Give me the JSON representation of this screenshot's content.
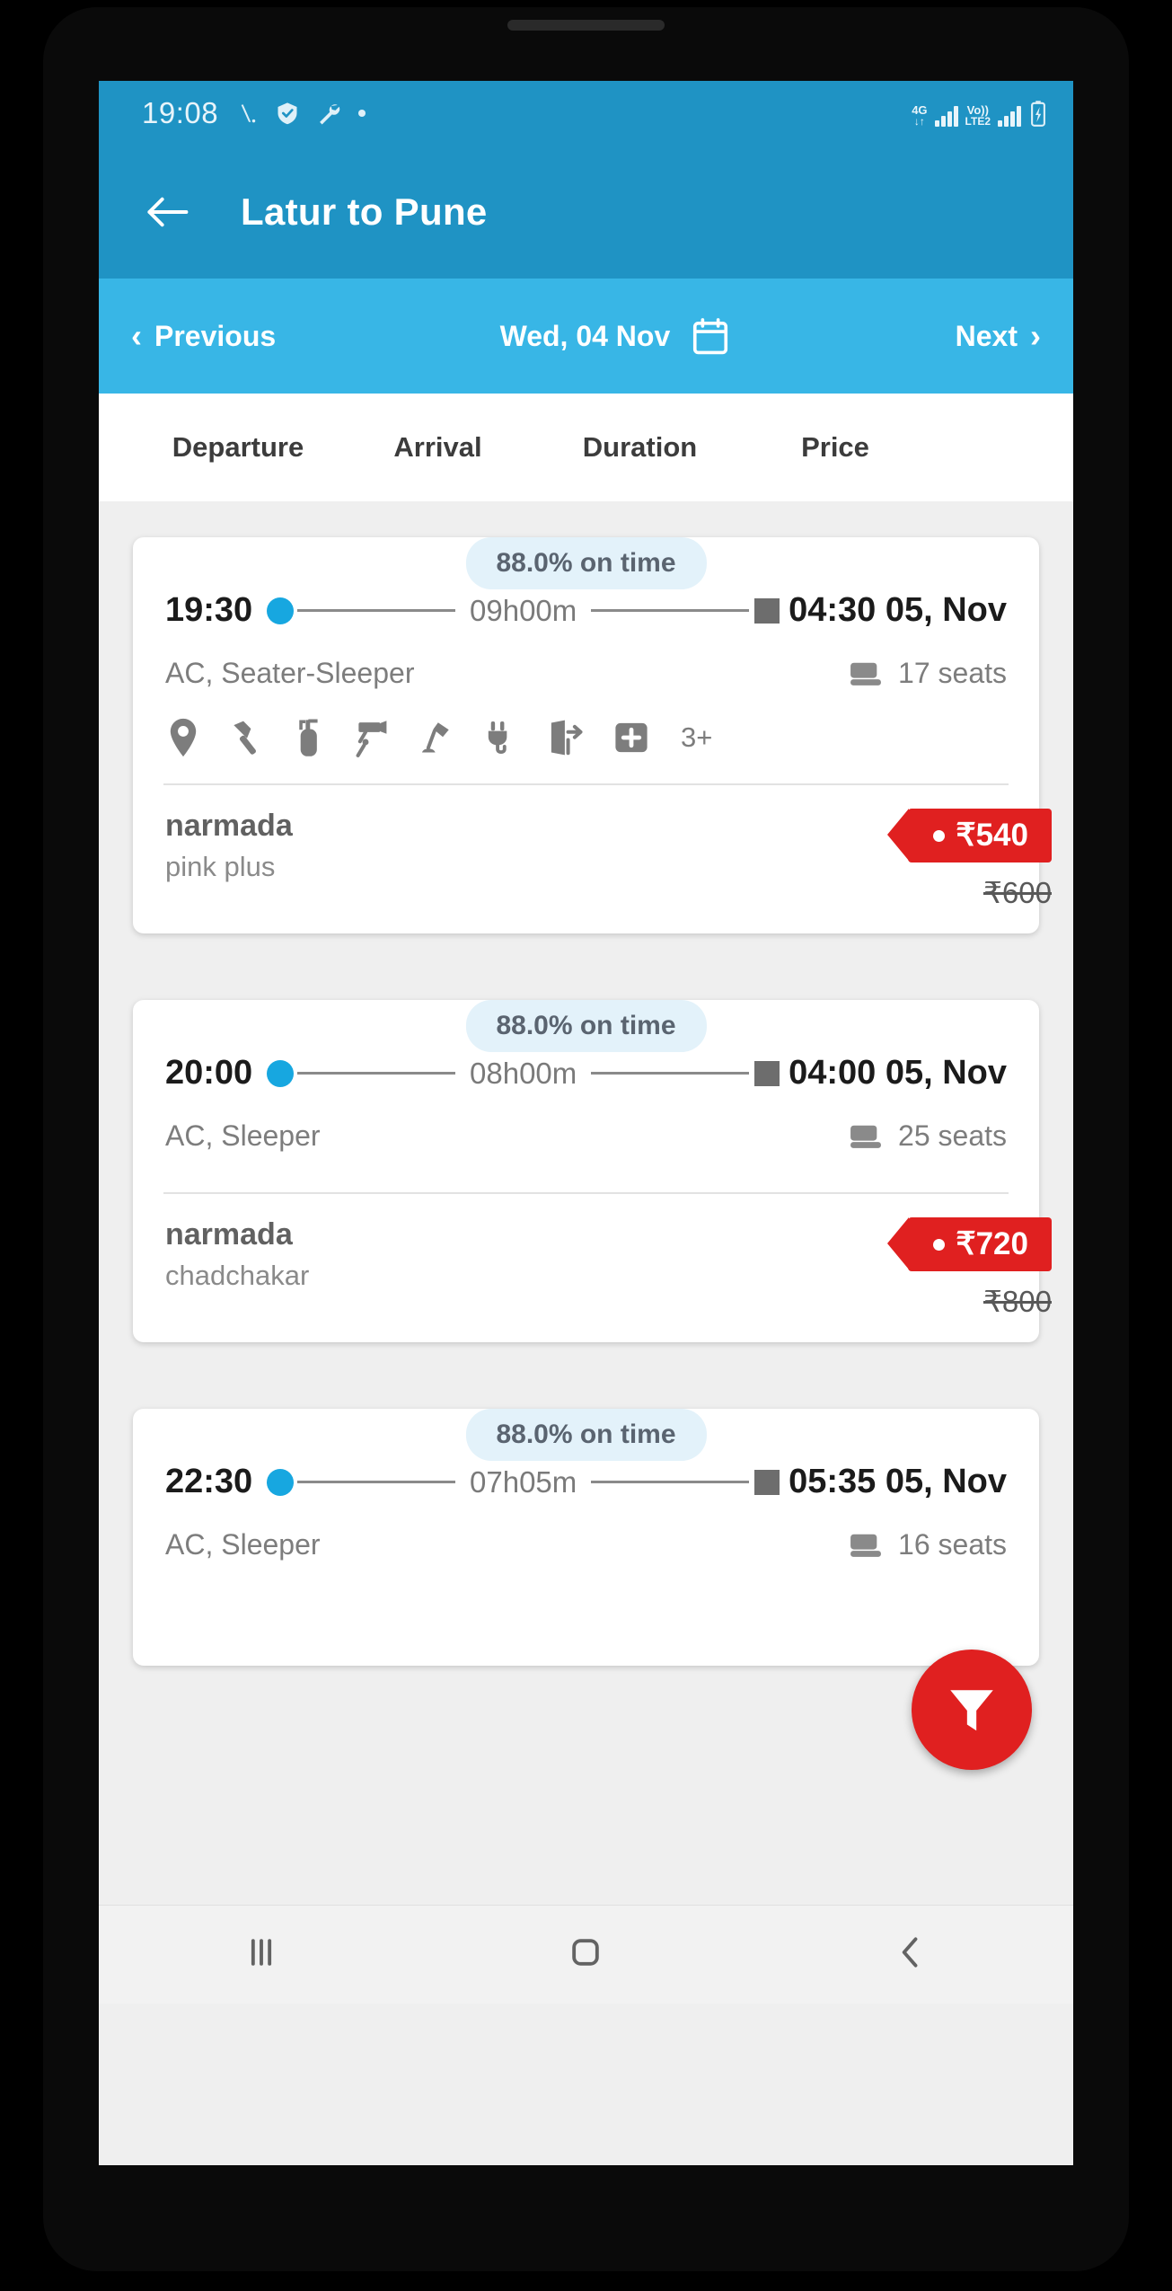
{
  "status_bar": {
    "time": "19:08",
    "icons": [
      "signal-slash-icon",
      "shield-check-icon",
      "wrench-icon",
      "dot-icon"
    ],
    "network_primary": "4G",
    "network_primary_sub": "↓↑",
    "network_secondary": "Vo))",
    "network_secondary_sub": "LTE2",
    "battery": "battery-charging-icon"
  },
  "appbar": {
    "back": "back-arrow-icon",
    "title": "Latur to Pune"
  },
  "datebar": {
    "previous_label": "Previous",
    "previous_chevron": "‹",
    "date": "Wed, 04 Nov",
    "calendar_icon": "calendar-icon",
    "next_label": "Next",
    "next_chevron": "›"
  },
  "column_headers": {
    "departure": "Departure",
    "arrival": "Arrival",
    "duration": "Duration",
    "price": "Price"
  },
  "colors": {
    "appbar": "#1f93c4",
    "datebar": "#38b6e6",
    "accent_dot": "#17a7e0",
    "price_red": "#e02020",
    "badge_bg": "#e3f2fa"
  },
  "fab": {
    "icon": "filter-funnel-icon",
    "label": "Filter"
  },
  "navbar": {
    "recents": "recents-icon",
    "home": "home-icon",
    "back": "back-icon"
  },
  "buses": [
    {
      "on_time": "88.0% on time",
      "departure": "19:30",
      "duration": "09h00m",
      "arrival": "04:30 05, Nov",
      "bus_type": "AC, Seater-Sleeper",
      "seats": "17 seats",
      "amenities": [
        "location-pin-icon",
        "hammer-icon",
        "fire-extinguisher-icon",
        "cctv-camera-icon",
        "reading-lamp-icon",
        "charging-plug-icon",
        "emergency-exit-icon",
        "first-aid-kit-icon"
      ],
      "amenities_more": "3+",
      "operator": "narmada",
      "operator_sub": "pink plus",
      "price": "₹540",
      "price_old": "₹600"
    },
    {
      "on_time": "88.0% on time",
      "departure": "20:00",
      "duration": "08h00m",
      "arrival": "04:00 05, Nov",
      "bus_type": "AC, Sleeper",
      "seats": "25 seats",
      "amenities": [],
      "amenities_more": "",
      "operator": "narmada",
      "operator_sub": "chadchakar",
      "price": "₹720",
      "price_old": "₹800"
    },
    {
      "on_time": "88.0% on time",
      "departure": "22:30",
      "duration": "07h05m",
      "arrival": "05:35 05, Nov",
      "bus_type": "AC, Sleeper",
      "seats": "16 seats",
      "amenities": [],
      "amenities_more": "",
      "operator": "",
      "operator_sub": "",
      "price": "",
      "price_old": ""
    }
  ]
}
